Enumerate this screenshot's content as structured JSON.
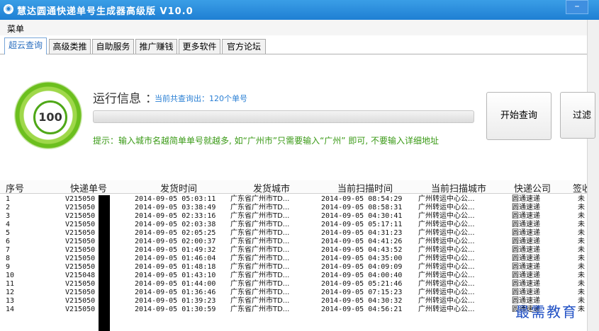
{
  "app": {
    "title": "慧达圆通快递单号生成器高级版 V10.0",
    "icon": "app-logo-icon",
    "minimize": "–"
  },
  "menubar": {
    "menu": "菜单"
  },
  "tabs": [
    "超云查询",
    "高级类推",
    "自助服务",
    "推广赚钱",
    "更多软件",
    "官方论坛"
  ],
  "active_tab": 0,
  "status": {
    "gauge_value": "100",
    "info_label": "运行信息",
    "info_colon": "：",
    "count_text": "当前共查询出：120个单号",
    "progress": 0,
    "tip": "提示：输入城市名越简单单号就越多, 如“广州市”只需要输入“广州” 即可, 不要输入详细地址"
  },
  "buttons": {
    "start": "开始查询",
    "filter": "过滤"
  },
  "table": {
    "columns": [
      "序号",
      "快递单号",
      "发货时间",
      "发货城市",
      "当前扫描时间",
      "当前扫描城市",
      "快递公司",
      "签收"
    ],
    "rows": [
      [
        "1",
        "V215050",
        "2014-09-05 05:03:11",
        "广东省广州市TD...",
        "2014-09-05 08:54:29",
        "广州转运中心公...",
        "圆通速递",
        "未"
      ],
      [
        "2",
        "V215050",
        "2014-09-05 03:38:49",
        "广东省广州市TD...",
        "2014-09-05 08:58:31",
        "广州转运中心公...",
        "圆通速递",
        "未"
      ],
      [
        "3",
        "V215050",
        "2014-09-05 02:33:16",
        "广东省广州市TD...",
        "2014-09-05 04:30:41",
        "广州转运中心公...",
        "圆通速递",
        "未"
      ],
      [
        "4",
        "V215050",
        "2014-09-05 02:03:38",
        "广东省广州市TD...",
        "2014-09-05 05:17:11",
        "广州转运中心公...",
        "圆通速递",
        "未"
      ],
      [
        "5",
        "V215050",
        "2014-09-05 02:05:25",
        "广东省广州市TD...",
        "2014-09-05 04:31:23",
        "广州转运中心公...",
        "圆通速递",
        "未"
      ],
      [
        "6",
        "V215050",
        "2014-09-05 02:00:37",
        "广东省广州市TD...",
        "2014-09-05 04:41:26",
        "广州转运中心公...",
        "圆通速递",
        "未"
      ],
      [
        "7",
        "V215050",
        "2014-09-05 01:49:32",
        "广东省广州市TD...",
        "2014-09-05 04:43:52",
        "广州转运中心公...",
        "圆通速递",
        "未"
      ],
      [
        "8",
        "V215050",
        "2014-09-05 01:46:04",
        "广东省广州市TD...",
        "2014-09-05 04:35:00",
        "广州转运中心公...",
        "圆通速递",
        "未"
      ],
      [
        "9",
        "V215050",
        "2014-09-05 01:48:18",
        "广东省广州市TD...",
        "2014-09-05 04:09:09",
        "广州转运中心公...",
        "圆通速递",
        "未"
      ],
      [
        "10",
        "V215048",
        "2014-09-05 01:43:10",
        "广东省广州市TD...",
        "2014-09-05 04:00:40",
        "广州转运中心公...",
        "圆通速递",
        "未"
      ],
      [
        "11",
        "V215050",
        "2014-09-05 01:44:00",
        "广东省广州市TD...",
        "2014-09-05 05:21:46",
        "广州转运中心公...",
        "圆通速递",
        "未"
      ],
      [
        "12",
        "V215050",
        "2014-09-05 01:36:46",
        "广东省广州市TD...",
        "2014-09-05 07:15:23",
        "广州转运中心公...",
        "圆通速递",
        "未"
      ],
      [
        "13",
        "V215050",
        "2014-09-05 01:39:23",
        "广东省广州市TD...",
        "2014-09-05 04:30:32",
        "广州转运中心公...",
        "圆通速递",
        "未"
      ],
      [
        "14",
        "V215050",
        "2014-09-05 01:30:59",
        "广东省广州市TD...",
        "2014-09-05 04:56:21",
        "广州转运中心公...",
        "圆通速递",
        "未"
      ]
    ]
  },
  "watermark": "最需教育",
  "colors": {
    "titlebar": "#1f7fd3",
    "accent": "#2a7fd4",
    "tip": "#3a9a16",
    "gauge": "#6cbf1e"
  }
}
